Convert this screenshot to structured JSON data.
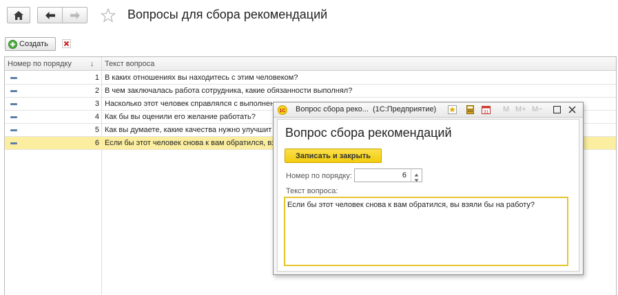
{
  "nav": {
    "home_icon": "home-icon",
    "back_icon": "arrow-left-icon",
    "forward_icon": "arrow-right-icon",
    "favorite_icon": "star-icon"
  },
  "page": {
    "title": "Вопросы для сбора рекомендаций"
  },
  "toolbar": {
    "create_label": "Создать",
    "create_icon": "plus-circle-icon",
    "delete_icon": "close-icon"
  },
  "table": {
    "columns": [
      "Номер по порядку",
      "↓",
      "Текст вопроса"
    ],
    "rows": [
      {
        "num": "1",
        "text": "В каких отношениях вы находитесь с этим человеком?",
        "selected": false
      },
      {
        "num": "2",
        "text": "В чем заключалась работа сотрудника, какие обязанности выполнял?",
        "selected": false
      },
      {
        "num": "3",
        "text": "Насколько этот человек справлялся с выполнен",
        "selected": false
      },
      {
        "num": "4",
        "text": "Как бы вы оценили его желание работать?",
        "selected": false
      },
      {
        "num": "5",
        "text": "Как вы думаете, какие качества нужно улучшит",
        "selected": false
      },
      {
        "num": "6",
        "text": "Если бы этот человек снова к вам обратился, вз",
        "selected": true
      }
    ]
  },
  "modal": {
    "window_title": "Вопрос сбора реко...  (1С:Предприятие)",
    "app_icon": "1c-logo-icon",
    "tools": {
      "m": "M",
      "m_plus": "M+",
      "m_minus": "M−"
    },
    "heading": "Вопрос сбора рекомендаций",
    "save_close_label": "Записать и закрыть",
    "order_label": "Номер по порядку:",
    "order_value": "6",
    "question_label": "Текст вопроса:",
    "question_value": "Если бы этот человек снова к вам обратился, вы взяли бы на работу?"
  },
  "colors": {
    "accent_yellow": "#f5d20e",
    "selected_row": "#fbeea0",
    "focus_border": "#e6c42a"
  }
}
